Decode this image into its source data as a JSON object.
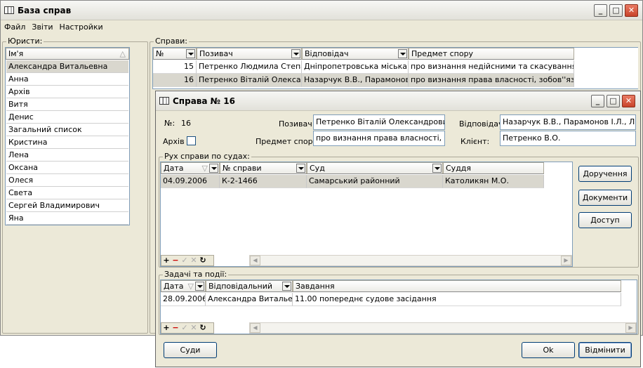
{
  "main_window": {
    "title": "База справ",
    "menu": [
      "Файл",
      "Звіти",
      "Настройки"
    ],
    "lawyers": {
      "group_label": "Юристи:",
      "header": "Ім'я",
      "items": [
        "Александра Витальевна",
        "Анна",
        "Архів",
        "Витя",
        "Денис",
        "Загальний список",
        "Кристина",
        "Лена",
        "Оксана",
        "Олеся",
        "Света",
        "Сергей Владимирович",
        "Яна"
      ]
    },
    "cases": {
      "group_label": "Справи:",
      "columns": [
        "№",
        "Позивач",
        "Відповідач",
        "Предмет спору"
      ],
      "rows": [
        {
          "no": "15",
          "plaintiff": "Петренко Людмила Степанівна",
          "defendant": "Дніпропетровська міська рада",
          "subject": "про визнання недійсними та скасування рішень"
        },
        {
          "no": "16",
          "plaintiff": "Петренко Віталій Олександрович",
          "defendant": "Назарчук В.В., Парамонов І.Л.",
          "subject": "про визнання права власності, зобов''язання"
        }
      ]
    }
  },
  "case_window": {
    "title": "Справа № 16",
    "number_label": "№:",
    "number_value": "16",
    "archive_label": "Архів",
    "plaintiff_label": "Позивач:",
    "plaintiff_value": "Петренко Віталій Олександрович",
    "subject_label": "Предмет спору:",
    "subject_value": "про визнання права власності, зобов'язання",
    "defendant_label": "Відповідач:",
    "defendant_value": "Назарчук В.В., Парамонов І.Л., Ляхів",
    "client_label": "Клієнт:",
    "client_value": "Петренко В.О.",
    "movement": {
      "group_label": "Рух справи по судах:",
      "columns": [
        "Дата",
        "№ справи",
        "Суд",
        "Суддя"
      ],
      "rows": [
        {
          "date": "04.09.2006",
          "case_no": "К-2-1466",
          "court": "Самарський районний",
          "judge": "Католикян М.О."
        }
      ]
    },
    "side_buttons": [
      "Доручення",
      "Документи",
      "Доступ"
    ],
    "tasks": {
      "group_label": "Задачі та події:",
      "columns": [
        "Дата",
        "Відповідальний",
        "Завдання"
      ],
      "rows": [
        {
          "date": "28.09.2006",
          "responsible": "Александра Витальевна",
          "task": "11.00 попереднє судове засідання"
        }
      ]
    },
    "courts_button": "Суди",
    "ok_button": "Ok",
    "cancel_button": "Відмінити"
  },
  "icons": {
    "app": "database-icon",
    "sort": "sort-triangle-icon",
    "nav": [
      "add-icon",
      "delete-icon",
      "post-icon",
      "cancel-edit-icon",
      "refresh-icon"
    ]
  }
}
